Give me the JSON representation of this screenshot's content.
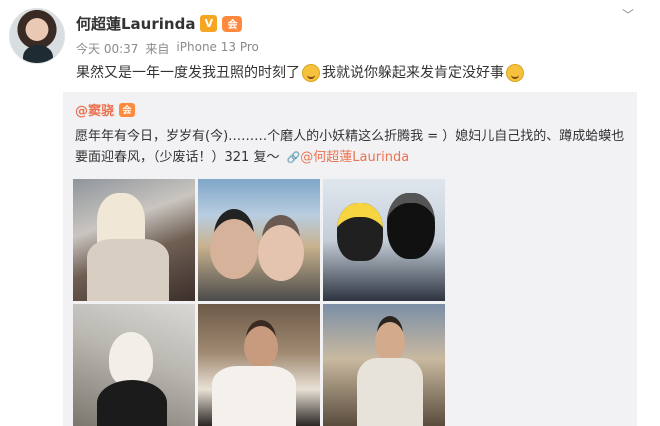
{
  "post": {
    "username": "何超蓮Laurinda",
    "verified_badge": "V",
    "member_badge": "会",
    "timestamp": "今天 00:37",
    "source_prefix": "来自",
    "source_device": "iPhone 13 Pro",
    "text_part1": "果然又是一年一度发我丑照的时刻了",
    "text_part2": "我就说你躲起来发肯定没好事",
    "emoji_1": "smile-emoji",
    "emoji_2": "laugh-emoji"
  },
  "repost": {
    "username": "@窦骁",
    "member_badge": "会",
    "text_main": "愿年年有今日，岁岁有(今)………个磨人的小妖精这么折腾我 = ）媳妇儿自己找的、蹲成蛤蟆也要面迎春风，（少废话！）321 复～",
    "mention": "@何超蓮Laurinda",
    "photos": [
      {
        "name": "photo-winter-hat"
      },
      {
        "name": "photo-selfie-building"
      },
      {
        "name": "photo-ski-goggles"
      },
      {
        "name": "photo-snow-ground"
      },
      {
        "name": "photo-makeup-room"
      },
      {
        "name": "photo-balcony-city"
      }
    ]
  },
  "icons": {
    "menu": "chevron-down-icon",
    "link": "link-icon"
  }
}
